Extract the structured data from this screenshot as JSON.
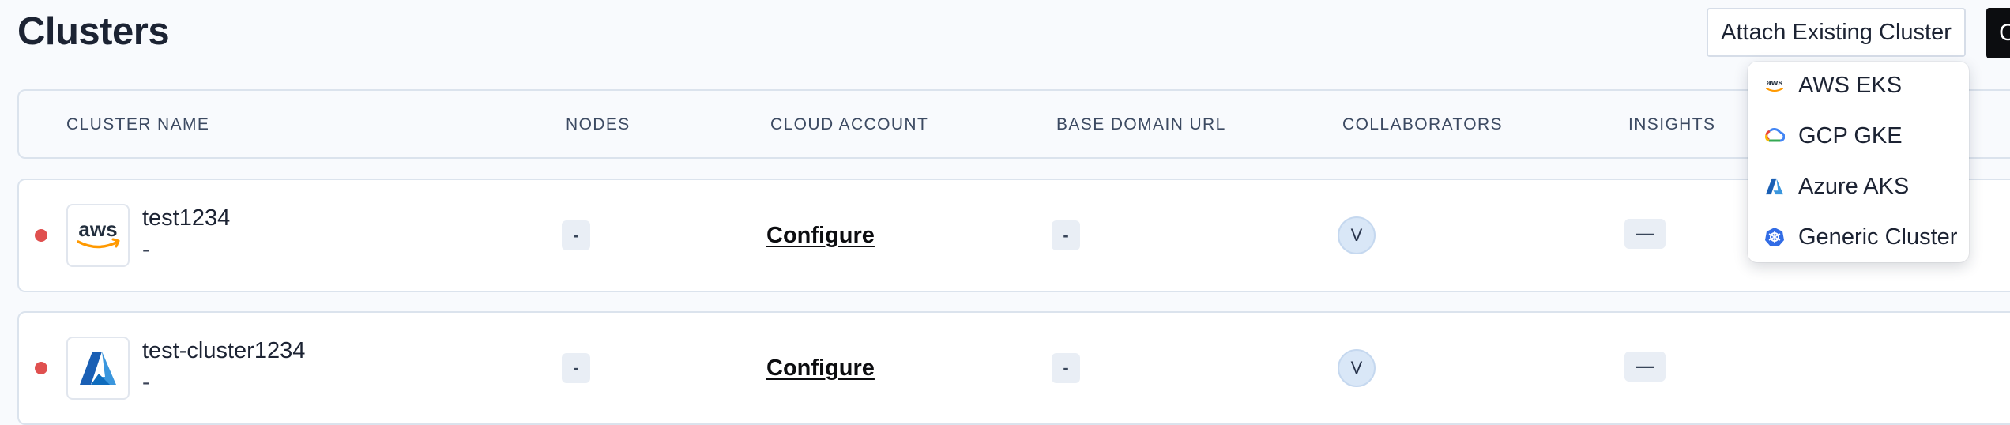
{
  "header": {
    "title": "Clusters",
    "attach_label": "Attach Existing Cluster",
    "create_label": "C"
  },
  "table": {
    "columns": [
      "CLUSTER NAME",
      "NODES",
      "CLOUD ACCOUNT",
      "BASE DOMAIN URL",
      "COLLABORATORS",
      "INSIGHTS"
    ],
    "rows": [
      {
        "status": "error",
        "provider_icon": "aws-logo-icon",
        "logo_text": "aws",
        "name": "test1234",
        "subtitle": "-",
        "nodes": "-",
        "cloud_account": "Configure",
        "base_domain": "-",
        "collaborator_initial": "V",
        "insights": "—"
      },
      {
        "status": "error",
        "provider_icon": "azure-logo-icon",
        "name": "test-cluster1234",
        "subtitle": "-",
        "nodes": "-",
        "cloud_account": "Configure",
        "base_domain": "-",
        "collaborator_initial": "V",
        "insights": "—"
      }
    ]
  },
  "dropdown": {
    "items": [
      {
        "label": "AWS EKS",
        "icon": "aws-icon",
        "icon_text": "aws"
      },
      {
        "label": "GCP GKE",
        "icon": "gcp-icon"
      },
      {
        "label": "Azure AKS",
        "icon": "azure-icon"
      },
      {
        "label": "Generic Cluster",
        "icon": "kubernetes-icon"
      }
    ]
  },
  "colors": {
    "status_error": "#e0504f",
    "aws_orange": "#ff9900",
    "azure_blue": "#0f6cbd",
    "kubernetes_blue": "#326ce5"
  }
}
